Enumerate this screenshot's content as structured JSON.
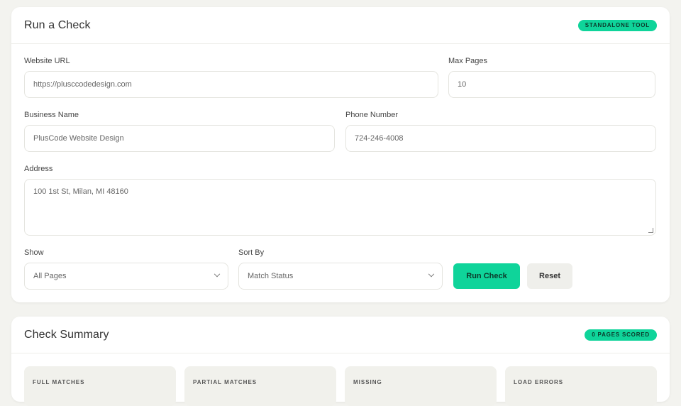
{
  "run_check": {
    "title": "Run a Check",
    "badge": "STANDALONE TOOL",
    "website_url": {
      "label": "Website URL",
      "value": "https://plusccodedesign.com"
    },
    "max_pages": {
      "label": "Max Pages",
      "value": "10"
    },
    "business_name": {
      "label": "Business Name",
      "value": "PlusCode Website Design"
    },
    "phone_number": {
      "label": "Phone Number",
      "value": "724-246-4008"
    },
    "address": {
      "label": "Address",
      "value": "100 1st St, Milan, MI 48160"
    },
    "show": {
      "label": "Show",
      "value": "All Pages"
    },
    "sort_by": {
      "label": "Sort By",
      "value": "Match Status"
    },
    "run_button": "Run Check",
    "reset_button": "Reset"
  },
  "summary": {
    "title": "Check Summary",
    "badge": "0 PAGES SCORED",
    "tiles": [
      {
        "label": "FULL MATCHES"
      },
      {
        "label": "PARTIAL MATCHES"
      },
      {
        "label": "MISSING"
      },
      {
        "label": "LOAD ERRORS"
      }
    ]
  },
  "colors": {
    "accent": "#0fd49a",
    "background": "#f3f3ef",
    "card": "#ffffff"
  }
}
